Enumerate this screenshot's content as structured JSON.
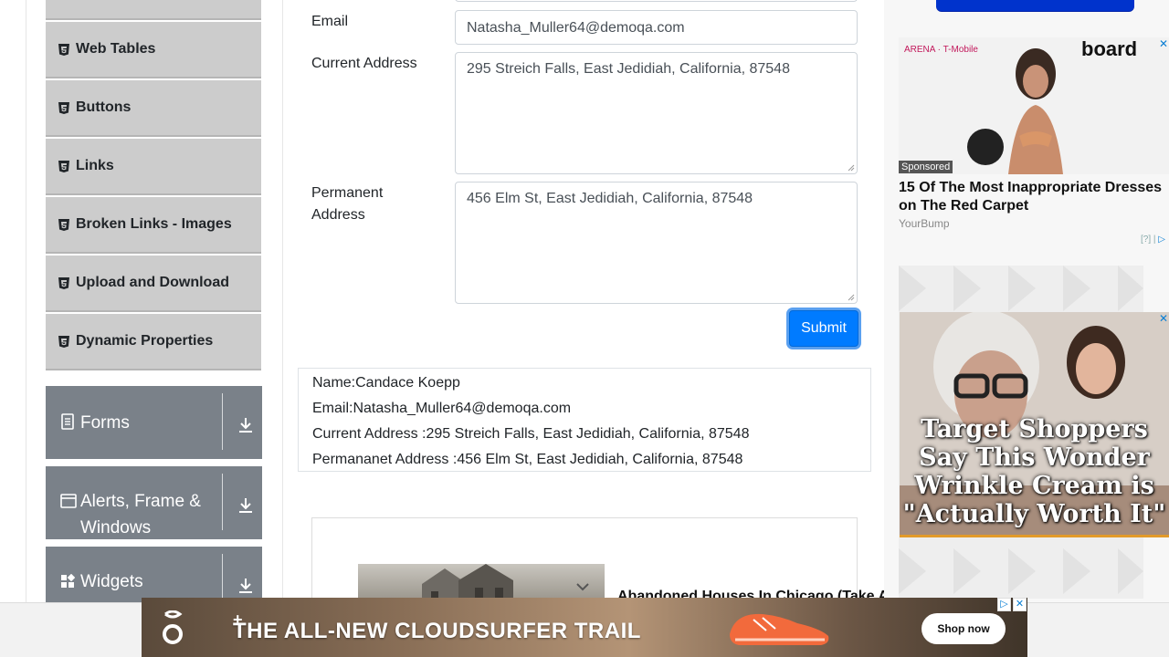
{
  "sidebar": {
    "elements_items": [
      {
        "label": "Web Tables"
      },
      {
        "label": "Buttons"
      },
      {
        "label": "Links"
      },
      {
        "label": "Broken Links - Images"
      },
      {
        "label": "Upload and Download"
      },
      {
        "label": "Dynamic Properties"
      }
    ],
    "groups": [
      {
        "label": "Forms",
        "icon": "document-icon"
      },
      {
        "label": "Alerts, Frame & Windows",
        "icon": "window-icon"
      },
      {
        "label": "Widgets",
        "icon": "widgets-icon"
      }
    ]
  },
  "form": {
    "email_label": "Email",
    "email_value": "Natasha_Muller64@demoqa.com",
    "current_address_label": "Current Address",
    "current_address_value": "295 Streich Falls, East Jedidiah, California, 87548",
    "permanent_address_label": "Permanent Address",
    "permanent_address_value": "456 Elm St, East Jedidiah, California, 87548",
    "submit_label": "Submit",
    "accent_color": "#007bff"
  },
  "output": {
    "name": "Name:Candace Koepp",
    "email": "Email:Natasha_Muller64@demoqa.com",
    "current_address": "Current Address :295 Streich Falls, East Jedidiah, California, 87548",
    "permanent_address": "Permananet Address :456 Elm St, East Jedidiah, California, 87548"
  },
  "ads": {
    "article_headline": "Abandoned Houses In Chicago (Take A",
    "right_ad_sponsored": "Sponsored",
    "right_ad_title": "15 Of The Most Inappropriate Dresses on The Red Carpet",
    "right_ad_source": "YourBump",
    "right_ad_meta": "[?]",
    "right_ad2_text": "Target Shoppers Say This Wonder Wrinkle Cream is \"Actually Worth It\"",
    "bottom_ad_headline": "THE ALL-NEW CLOUDSURFER TRAIL",
    "bottom_ad_cta": "Shop now"
  }
}
